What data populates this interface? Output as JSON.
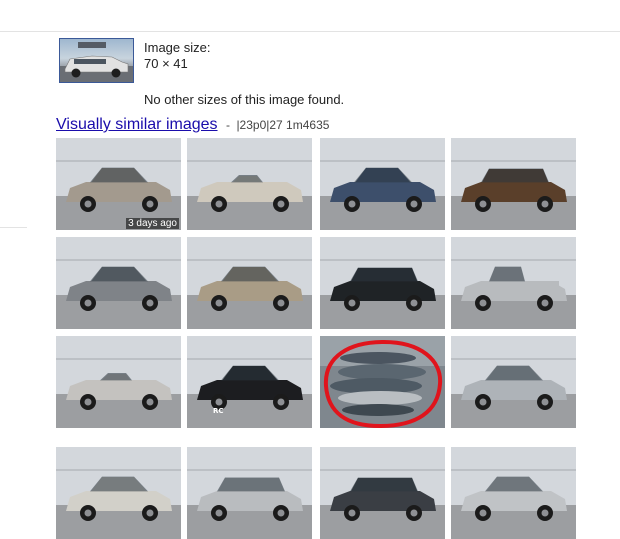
{
  "original_image": {
    "size_label": "Image size:",
    "size_value": "70 × 41",
    "no_other_sizes": "No other sizes of this image found."
  },
  "similar": {
    "link_label": "Visually similar images",
    "separator": "-",
    "meta": "|23p0|27 1m4635",
    "tiles": [
      {
        "subject": "silver hatchback car",
        "body_color": "#a39a8e",
        "caption": "3 days ago"
      },
      {
        "subject": "white convertible car",
        "body_color": "#cfc9bd"
      },
      {
        "subject": "blue compact car",
        "body_color": "#3d4f6b"
      },
      {
        "subject": "brown suv",
        "body_color": "#5a3f2a"
      },
      {
        "subject": "grey sedan",
        "body_color": "#7f8388"
      },
      {
        "subject": "champagne sedan",
        "body_color": "#a99c86"
      },
      {
        "subject": "black station wagon",
        "body_color": "#1f2326"
      },
      {
        "subject": "silver pickup truck",
        "body_color": "#b8bbbe"
      },
      {
        "subject": "silver roadster",
        "body_color": "#c4c2bf"
      },
      {
        "subject": "black hatchback car",
        "body_color": "#1c1d20",
        "badge": "RC"
      },
      {
        "subject": "dolphins photo",
        "circle_color": "#e0141c"
      },
      {
        "subject": "silver hatchback car",
        "body_color": "#aeb3b8"
      },
      {
        "subject": "white sedan",
        "body_color": "#d2d0c9"
      },
      {
        "subject": "silver station wagon",
        "body_color": "#b9bcbf"
      },
      {
        "subject": "dark grey suv",
        "body_color": "#3a3e44"
      },
      {
        "subject": "silver hatchback car",
        "body_color": "#c0c3c6"
      }
    ]
  },
  "colors": {
    "link": "#1a0dab",
    "thumbnail_border": "#3b5998"
  }
}
